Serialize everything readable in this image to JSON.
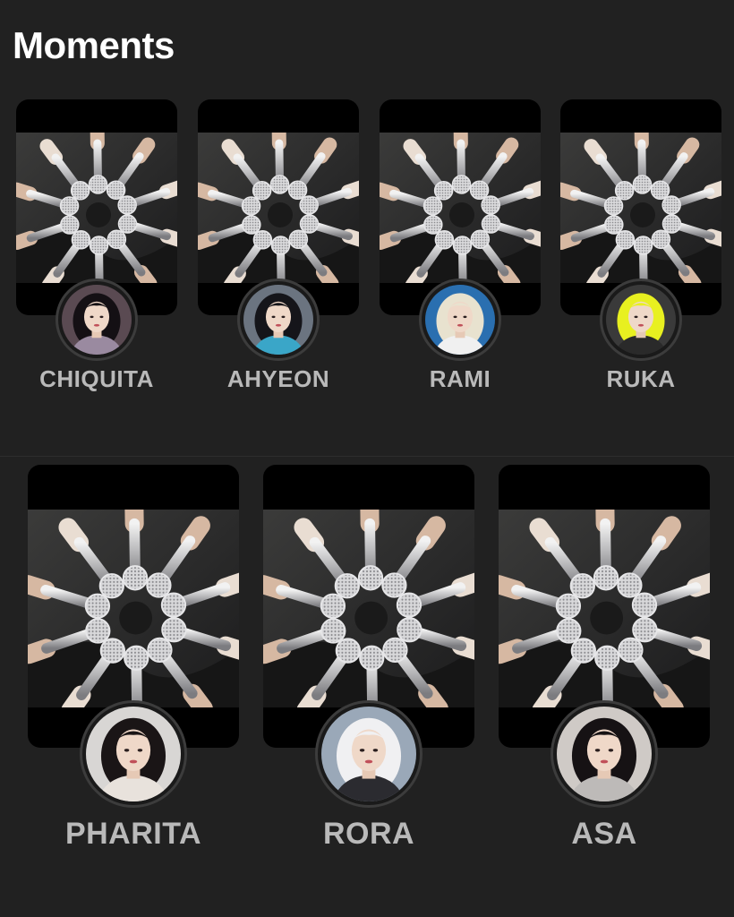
{
  "header": {
    "title": "Moments"
  },
  "moments": [
    {
      "name": "CHIQUITA",
      "avatar_bg": "#5a4a52",
      "hair": "#141014",
      "accent": "#9a8aa0"
    },
    {
      "name": "AHYEON",
      "avatar_bg": "#6b7480",
      "hair": "#15151a",
      "accent": "#3aa6c8"
    },
    {
      "name": "RAMI",
      "avatar_bg": "#2a6fb0",
      "hair": "#e8e2cf",
      "accent": "#f0f0f0"
    },
    {
      "name": "RUKA",
      "avatar_bg": "#3a3a3a",
      "hair": "#e8f020",
      "accent": "#2a2a2a"
    },
    {
      "name": "PHARITA",
      "avatar_bg": "#d8d6d4",
      "hair": "#1a1516",
      "accent": "#e8e2dc"
    },
    {
      "name": "RORA",
      "avatar_bg": "#9aa8b8",
      "hair": "#f0f0f2",
      "accent": "#2b2b30"
    },
    {
      "name": "ASA",
      "avatar_bg": "#cfcac6",
      "hair": "#161214",
      "accent": "#bdbab8"
    }
  ],
  "icons": {
    "story_photo": "microphones-circle-photo",
    "avatar": "profile-avatar-icon"
  }
}
